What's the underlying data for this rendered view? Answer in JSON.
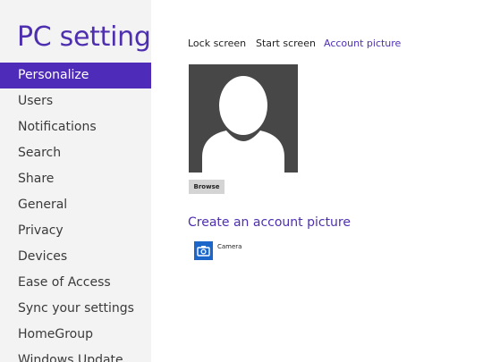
{
  "sidebar": {
    "title": "PC settings",
    "items": [
      {
        "label": "Personalize",
        "selected": true
      },
      {
        "label": "Users"
      },
      {
        "label": "Notifications"
      },
      {
        "label": "Search"
      },
      {
        "label": "Share"
      },
      {
        "label": "General"
      },
      {
        "label": "Privacy"
      },
      {
        "label": "Devices"
      },
      {
        "label": "Ease of Access"
      },
      {
        "label": "Sync your settings"
      },
      {
        "label": "HomeGroup"
      },
      {
        "label": "Windows Update"
      }
    ]
  },
  "main": {
    "tabs": [
      {
        "label": "Lock screen"
      },
      {
        "label": "Start screen"
      },
      {
        "label": "Account picture",
        "active": true
      }
    ],
    "browse_label": "Browse",
    "create_heading": "Create an account picture",
    "apps": [
      {
        "label": "Camera",
        "icon": "camera-icon"
      }
    ]
  },
  "colors": {
    "accent": "#4e2fb0",
    "selected_bg": "#4e2bb8",
    "sidebar_bg": "#f3f3f3",
    "picture_bg": "#474747",
    "camera_tile": "#1d66c9"
  }
}
